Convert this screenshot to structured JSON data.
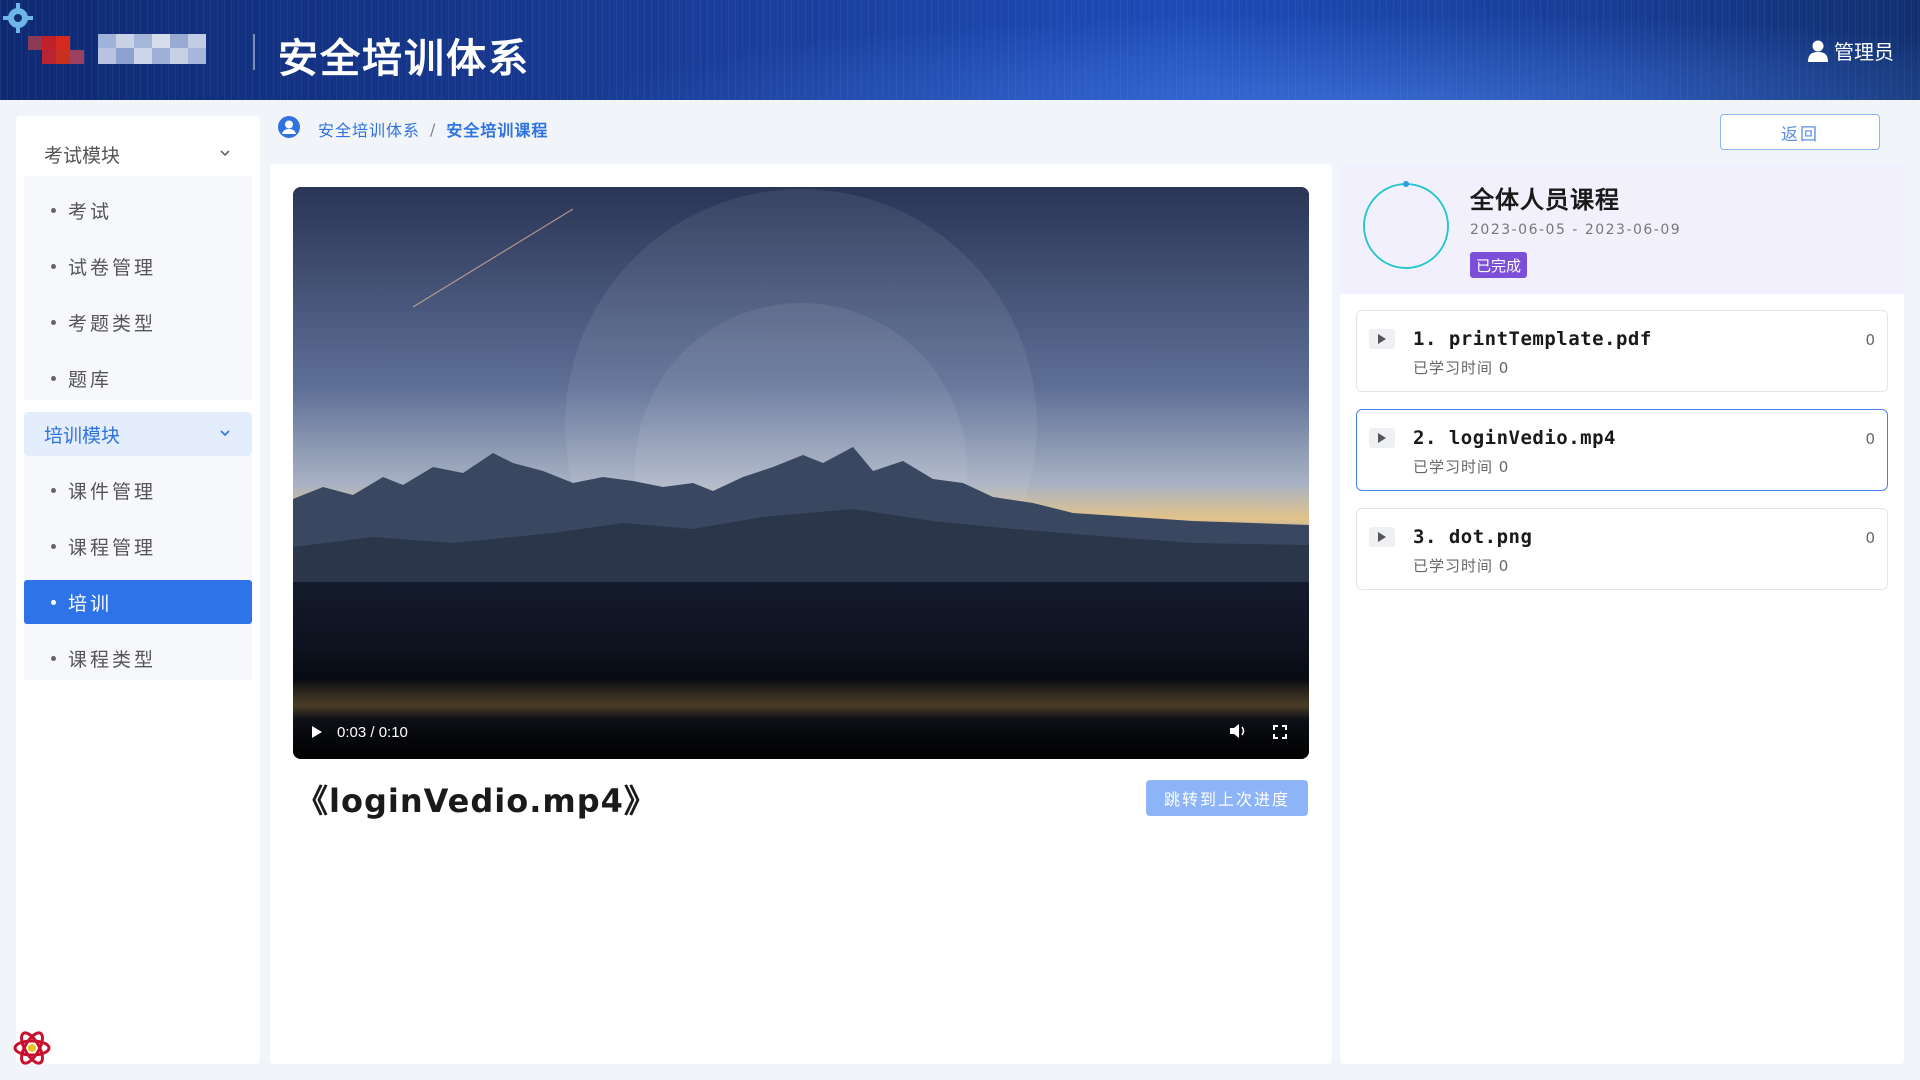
{
  "header": {
    "title": "安全培训体系",
    "user_label": "管理员"
  },
  "sidebar": {
    "groups": [
      {
        "label": "考试模块",
        "items": [
          {
            "label": "考试"
          },
          {
            "label": "试卷管理"
          },
          {
            "label": "考题类型"
          },
          {
            "label": "题库"
          }
        ]
      },
      {
        "label": "培训模块",
        "items": [
          {
            "label": "课件管理"
          },
          {
            "label": "课程管理"
          },
          {
            "label": "培训"
          },
          {
            "label": "课程类型"
          }
        ]
      }
    ]
  },
  "breadcrumb": {
    "root": "安全培训体系",
    "separator": "/",
    "current": "安全培训课程"
  },
  "toolbar": {
    "back_label": "返回"
  },
  "player": {
    "current_time": "0:03",
    "duration": "0:10",
    "time_display": "0:03 / 0:10",
    "progress_fraction": 0.3
  },
  "video": {
    "title": "《loginVedio.mp4》",
    "jump_label": "跳转到上次进度"
  },
  "course": {
    "title": "全体人员课程",
    "date_range": "2023-06-05 - 2023-06-09",
    "status": "已完成",
    "status_color": "#7b4fd8",
    "files": [
      {
        "name": "1. printTemplate.pdf",
        "study_time": "已学习时间 0",
        "count": "0"
      },
      {
        "name": "2. loginVedio.mp4",
        "study_time": "已学习时间 0",
        "count": "0"
      },
      {
        "name": "3. dot.png",
        "study_time": "已学习时间 0",
        "count": "0"
      }
    ]
  },
  "colors": {
    "accent": "#2f73e9",
    "header_bg": "#1a3f9c"
  }
}
